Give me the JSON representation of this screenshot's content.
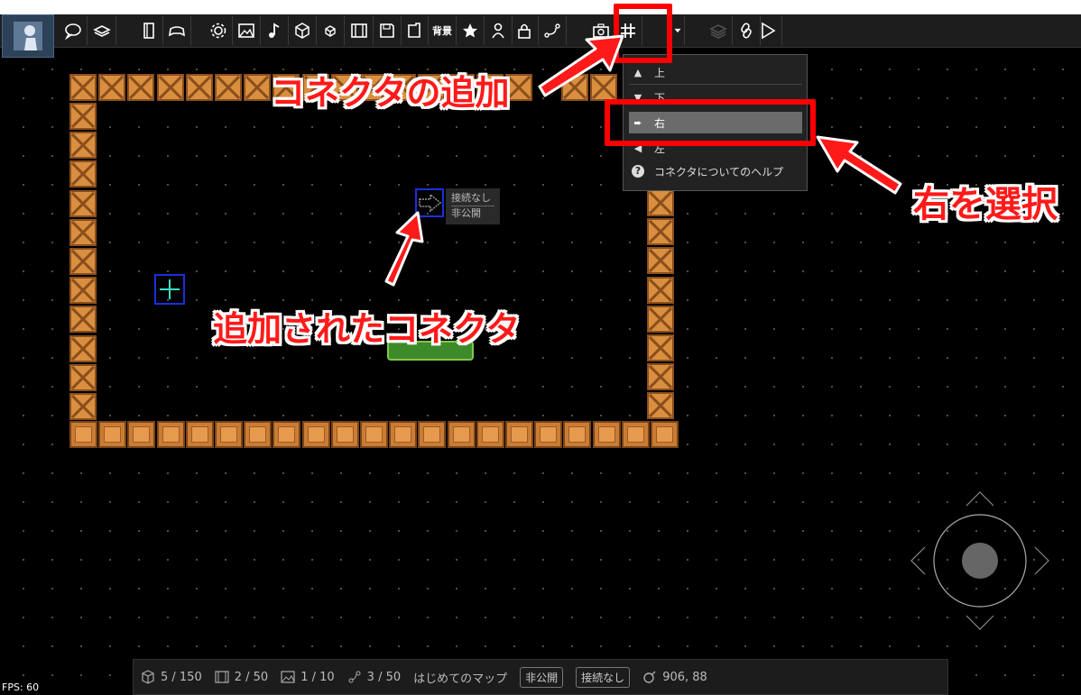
{
  "toolbar": {
    "buttons": [
      {
        "name": "speech-bubble-icon"
      },
      {
        "name": "layers-stack-icon"
      },
      {
        "name": "book-icon"
      },
      {
        "name": "gamepad-icon"
      },
      {
        "name": "gear-icon"
      },
      {
        "name": "image-icon"
      },
      {
        "name": "music-note-icon"
      },
      {
        "name": "cube-icon"
      },
      {
        "name": "small-cube-icon"
      },
      {
        "name": "film-icon"
      },
      {
        "name": "save-icon"
      },
      {
        "name": "export-icon"
      },
      {
        "name": "background-button",
        "label": "背景"
      },
      {
        "name": "star-icon"
      },
      {
        "name": "person-icon"
      },
      {
        "name": "lock-icon"
      },
      {
        "name": "connector-icon"
      },
      {
        "name": "camera-icon"
      },
      {
        "name": "grid-icon"
      },
      {
        "name": "dropdown-arrow-icon"
      },
      {
        "name": "layers-icon"
      },
      {
        "name": "link-icon"
      },
      {
        "name": "play-icon"
      }
    ]
  },
  "connector_menu": {
    "items": [
      {
        "icon": "up-icon",
        "label": "上"
      },
      {
        "icon": "down-icon",
        "label": "下"
      },
      {
        "icon": "right-icon",
        "label": "右",
        "selected": true
      },
      {
        "icon": "left-icon",
        "label": "左"
      },
      {
        "icon": "help-icon",
        "label": "コネクタについてのヘルプ"
      }
    ]
  },
  "connector": {
    "status": "接続なし",
    "visibility": "非公開"
  },
  "annotations": {
    "add_connector": "コネクタの追加",
    "select_right": "右を選択",
    "added_connector": "追加されたコネクタ",
    "color": "#ff0000"
  },
  "statusbar": {
    "objects": "5 / 150",
    "scenes": "2 / 50",
    "images": "1 / 10",
    "connectors": "3 / 50",
    "map_name": "はじめてのマップ",
    "visibility": "非公開",
    "connection": "接続なし",
    "cursor": "906, 88"
  },
  "fps": "FPS: 60"
}
